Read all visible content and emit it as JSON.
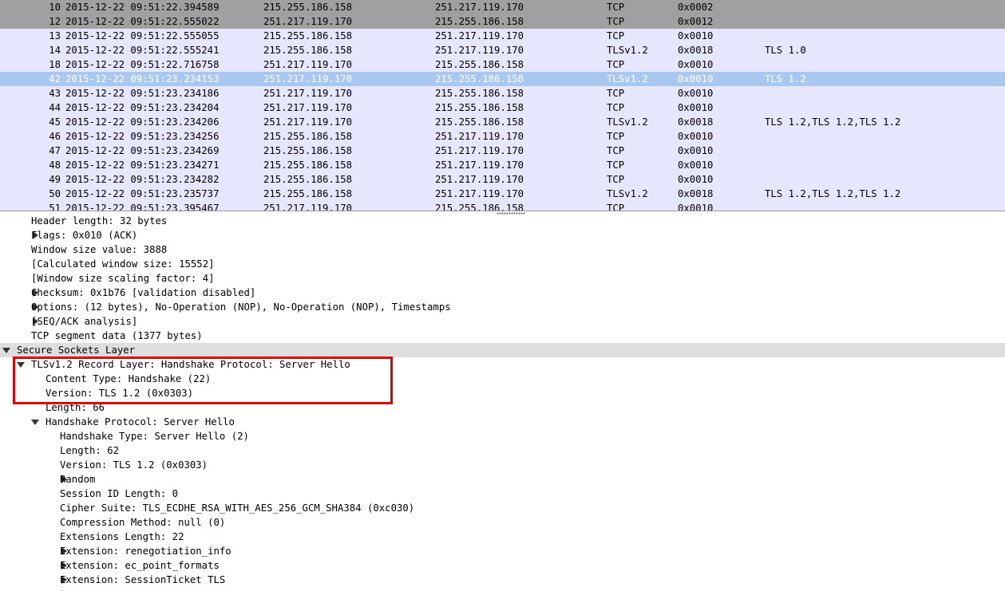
{
  "packets": [
    {
      "no": "10",
      "time": "2015-12-22 09:51:22.394589",
      "src": "215.255.186.158",
      "dst": "251.217.119.170",
      "proto": "TCP",
      "flags": "0x0002",
      "info": "",
      "bg": "#a0a0a0",
      "fg": "#000000"
    },
    {
      "no": "12",
      "time": "2015-12-22 09:51:22.555022",
      "src": "251.217.119.170",
      "dst": "215.255.186.158",
      "proto": "TCP",
      "flags": "0x0012",
      "info": "",
      "bg": "#a0a0a0",
      "fg": "#000000"
    },
    {
      "no": "13",
      "time": "2015-12-22 09:51:22.555055",
      "src": "215.255.186.158",
      "dst": "251.217.119.170",
      "proto": "TCP",
      "flags": "0x0010",
      "info": "",
      "bg": "#e7e6ff",
      "fg": "#000000"
    },
    {
      "no": "14",
      "time": "2015-12-22 09:51:22.555241",
      "src": "215.255.186.158",
      "dst": "251.217.119.170",
      "proto": "TLSv1.2",
      "flags": "0x0018",
      "info": "TLS 1.0",
      "bg": "#e7e6ff",
      "fg": "#000000"
    },
    {
      "no": "18",
      "time": "2015-12-22 09:51:22.716758",
      "src": "251.217.119.170",
      "dst": "215.255.186.158",
      "proto": "TCP",
      "flags": "0x0010",
      "info": "",
      "bg": "#e7e6ff",
      "fg": "#000000"
    },
    {
      "no": "42",
      "time": "2015-12-22 09:51:23.234153",
      "src": "251.217.119.170",
      "dst": "215.255.186.158",
      "proto": "TLSv1.2",
      "flags": "0x0010",
      "info": "TLS 1.2",
      "bg": "#a8c8f2",
      "fg": "#ffffff"
    },
    {
      "no": "43",
      "time": "2015-12-22 09:51:23.234186",
      "src": "251.217.119.170",
      "dst": "215.255.186.158",
      "proto": "TCP",
      "flags": "0x0010",
      "info": "",
      "bg": "#e7e6ff",
      "fg": "#000000"
    },
    {
      "no": "44",
      "time": "2015-12-22 09:51:23.234204",
      "src": "251.217.119.170",
      "dst": "215.255.186.158",
      "proto": "TCP",
      "flags": "0x0010",
      "info": "",
      "bg": "#e7e6ff",
      "fg": "#000000"
    },
    {
      "no": "45",
      "time": "2015-12-22 09:51:23.234206",
      "src": "251.217.119.170",
      "dst": "215.255.186.158",
      "proto": "TLSv1.2",
      "flags": "0x0018",
      "info": "TLS 1.2,TLS 1.2,TLS 1.2",
      "bg": "#e7e6ff",
      "fg": "#000000"
    },
    {
      "no": "46",
      "time": "2015-12-22 09:51:23.234256",
      "src": "215.255.186.158",
      "dst": "251.217.119.170",
      "proto": "TCP",
      "flags": "0x0010",
      "info": "",
      "bg": "#e7e6ff",
      "fg": "#000000"
    },
    {
      "no": "47",
      "time": "2015-12-22 09:51:23.234269",
      "src": "215.255.186.158",
      "dst": "251.217.119.170",
      "proto": "TCP",
      "flags": "0x0010",
      "info": "",
      "bg": "#e7e6ff",
      "fg": "#000000"
    },
    {
      "no": "48",
      "time": "2015-12-22 09:51:23.234271",
      "src": "215.255.186.158",
      "dst": "251.217.119.170",
      "proto": "TCP",
      "flags": "0x0010",
      "info": "",
      "bg": "#e7e6ff",
      "fg": "#000000"
    },
    {
      "no": "49",
      "time": "2015-12-22 09:51:23.234282",
      "src": "215.255.186.158",
      "dst": "251.217.119.170",
      "proto": "TCP",
      "flags": "0x0010",
      "info": "",
      "bg": "#e7e6ff",
      "fg": "#000000"
    },
    {
      "no": "50",
      "time": "2015-12-22 09:51:23.235737",
      "src": "215.255.186.158",
      "dst": "251.217.119.170",
      "proto": "TLSv1.2",
      "flags": "0x0018",
      "info": "TLS 1.2,TLS 1.2,TLS 1.2",
      "bg": "#e7e6ff",
      "fg": "#000000"
    },
    {
      "no": "51",
      "time": "2015-12-22 09:51:23.395467",
      "src": "251.217.119.170",
      "dst": "215.255.186.158",
      "proto": "TCP",
      "flags": "0x0010",
      "info": "",
      "bg": "#e7e6ff",
      "fg": "#000000"
    }
  ],
  "details": [
    {
      "text": "Header length: 32 bytes",
      "depth": 1,
      "expander": "none",
      "section": false
    },
    {
      "text": "Flags: 0x010 (ACK)",
      "depth": 1,
      "expander": "closed",
      "section": false
    },
    {
      "text": "Window size value: 3888",
      "depth": 1,
      "expander": "none",
      "section": false
    },
    {
      "text": "[Calculated window size: 15552]",
      "depth": 1,
      "expander": "none",
      "section": false
    },
    {
      "text": "[Window size scaling factor: 4]",
      "depth": 1,
      "expander": "none",
      "section": false
    },
    {
      "text": "Checksum: 0x1b76 [validation disabled]",
      "depth": 1,
      "expander": "closed",
      "section": false
    },
    {
      "text": "Options: (12 bytes), No-Operation (NOP), No-Operation (NOP), Timestamps",
      "depth": 1,
      "expander": "closed",
      "section": false
    },
    {
      "text": "[SEQ/ACK analysis]",
      "depth": 1,
      "expander": "closed",
      "section": false
    },
    {
      "text": "TCP segment data (1377 bytes)",
      "depth": 1,
      "expander": "none",
      "section": false
    },
    {
      "text": "Secure Sockets Layer",
      "depth": 0,
      "expander": "open",
      "section": true
    },
    {
      "text": "TLSv1.2 Record Layer: Handshake Protocol: Server Hello",
      "depth": 1,
      "expander": "open",
      "section": false
    },
    {
      "text": "Content Type: Handshake (22)",
      "depth": 2,
      "expander": "none",
      "section": false
    },
    {
      "text": "Version: TLS 1.2 (0x0303)",
      "depth": 2,
      "expander": "none",
      "section": false
    },
    {
      "text": "Length: 66",
      "depth": 2,
      "expander": "none",
      "section": false
    },
    {
      "text": "Handshake Protocol: Server Hello",
      "depth": 2,
      "expander": "open",
      "section": false
    },
    {
      "text": "Handshake Type: Server Hello (2)",
      "depth": 3,
      "expander": "none",
      "section": false
    },
    {
      "text": "Length: 62",
      "depth": 3,
      "expander": "none",
      "section": false
    },
    {
      "text": "Version: TLS 1.2 (0x0303)",
      "depth": 3,
      "expander": "none",
      "section": false
    },
    {
      "text": "Random",
      "depth": 3,
      "expander": "closed",
      "section": false
    },
    {
      "text": "Session ID Length: 0",
      "depth": 3,
      "expander": "none",
      "section": false
    },
    {
      "text": "Cipher Suite: TLS_ECDHE_RSA_WITH_AES_256_GCM_SHA384 (0xc030)",
      "depth": 3,
      "expander": "none",
      "section": false
    },
    {
      "text": "Compression Method: null (0)",
      "depth": 3,
      "expander": "none",
      "section": false
    },
    {
      "text": "Extensions Length: 22",
      "depth": 3,
      "expander": "none",
      "section": false
    },
    {
      "text": "Extension: renegotiation_info",
      "depth": 3,
      "expander": "closed",
      "section": false
    },
    {
      "text": "Extension: ec_point_formats",
      "depth": 3,
      "expander": "closed",
      "section": false
    },
    {
      "text": "Extension: SessionTicket TLS",
      "depth": 3,
      "expander": "closed",
      "section": false
    },
    {
      "text": "",
      "depth": 3,
      "expander": "closed",
      "section": false
    }
  ],
  "highlight_color": "#e00000"
}
